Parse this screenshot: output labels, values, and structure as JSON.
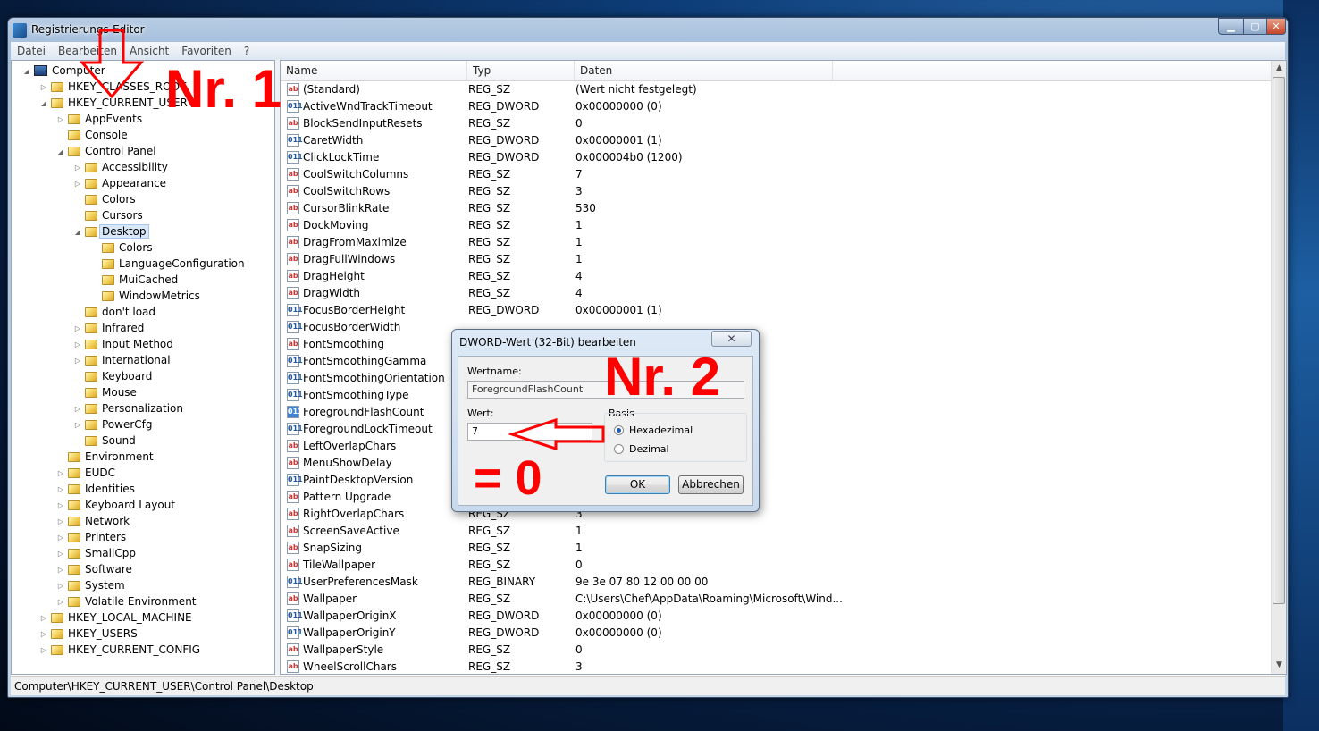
{
  "window": {
    "title": "Registrierungs-Editor",
    "min": "▁",
    "max": "▢",
    "close": "✕"
  },
  "menu": [
    "Datei",
    "Bearbeiten",
    "Ansicht",
    "Favoriten",
    "?"
  ],
  "tree": [
    {
      "label": "Computer",
      "level": 0,
      "exp": "◢",
      "icon": "pc"
    },
    {
      "label": "HKEY_CLASSES_ROOT",
      "level": 1,
      "exp": "▷"
    },
    {
      "label": "HKEY_CURRENT_USER",
      "level": 1,
      "exp": "◢"
    },
    {
      "label": "AppEvents",
      "level": 2,
      "exp": "▷"
    },
    {
      "label": "Console",
      "level": 2,
      "exp": ""
    },
    {
      "label": "Control Panel",
      "level": 2,
      "exp": "◢"
    },
    {
      "label": "Accessibility",
      "level": 3,
      "exp": "▷"
    },
    {
      "label": "Appearance",
      "level": 3,
      "exp": "▷"
    },
    {
      "label": "Colors",
      "level": 3,
      "exp": ""
    },
    {
      "label": "Cursors",
      "level": 3,
      "exp": ""
    },
    {
      "label": "Desktop",
      "level": 3,
      "exp": "◢",
      "selected": true
    },
    {
      "label": "Colors",
      "level": 4,
      "exp": ""
    },
    {
      "label": "LanguageConfiguration",
      "level": 4,
      "exp": ""
    },
    {
      "label": "MuiCached",
      "level": 4,
      "exp": ""
    },
    {
      "label": "WindowMetrics",
      "level": 4,
      "exp": ""
    },
    {
      "label": "don't load",
      "level": 3,
      "exp": ""
    },
    {
      "label": "Infrared",
      "level": 3,
      "exp": "▷"
    },
    {
      "label": "Input Method",
      "level": 3,
      "exp": "▷"
    },
    {
      "label": "International",
      "level": 3,
      "exp": "▷"
    },
    {
      "label": "Keyboard",
      "level": 3,
      "exp": ""
    },
    {
      "label": "Mouse",
      "level": 3,
      "exp": ""
    },
    {
      "label": "Personalization",
      "level": 3,
      "exp": "▷"
    },
    {
      "label": "PowerCfg",
      "level": 3,
      "exp": "▷"
    },
    {
      "label": "Sound",
      "level": 3,
      "exp": ""
    },
    {
      "label": "Environment",
      "level": 2,
      "exp": ""
    },
    {
      "label": "EUDC",
      "level": 2,
      "exp": "▷"
    },
    {
      "label": "Identities",
      "level": 2,
      "exp": "▷"
    },
    {
      "label": "Keyboard Layout",
      "level": 2,
      "exp": "▷"
    },
    {
      "label": "Network",
      "level": 2,
      "exp": "▷"
    },
    {
      "label": "Printers",
      "level": 2,
      "exp": "▷"
    },
    {
      "label": "SmallCpp",
      "level": 2,
      "exp": "▷"
    },
    {
      "label": "Software",
      "level": 2,
      "exp": "▷"
    },
    {
      "label": "System",
      "level": 2,
      "exp": "▷"
    },
    {
      "label": "Volatile Environment",
      "level": 2,
      "exp": "▷"
    },
    {
      "label": "HKEY_LOCAL_MACHINE",
      "level": 1,
      "exp": "▷"
    },
    {
      "label": "HKEY_USERS",
      "level": 1,
      "exp": "▷"
    },
    {
      "label": "HKEY_CURRENT_CONFIG",
      "level": 1,
      "exp": "▷"
    }
  ],
  "columns": [
    "Name",
    "Typ",
    "Daten"
  ],
  "rows": [
    {
      "name": "(Standard)",
      "type": "REG_SZ",
      "data": "(Wert nicht festgelegt)",
      "icon": "ab"
    },
    {
      "name": "ActiveWndTrackTimeout",
      "type": "REG_DWORD",
      "data": "0x00000000 (0)",
      "icon": "bin"
    },
    {
      "name": "BlockSendInputResets",
      "type": "REG_SZ",
      "data": "0",
      "icon": "ab"
    },
    {
      "name": "CaretWidth",
      "type": "REG_DWORD",
      "data": "0x00000001 (1)",
      "icon": "bin"
    },
    {
      "name": "ClickLockTime",
      "type": "REG_DWORD",
      "data": "0x000004b0 (1200)",
      "icon": "bin"
    },
    {
      "name": "CoolSwitchColumns",
      "type": "REG_SZ",
      "data": "7",
      "icon": "ab"
    },
    {
      "name": "CoolSwitchRows",
      "type": "REG_SZ",
      "data": "3",
      "icon": "ab"
    },
    {
      "name": "CursorBlinkRate",
      "type": "REG_SZ",
      "data": "530",
      "icon": "ab"
    },
    {
      "name": "DockMoving",
      "type": "REG_SZ",
      "data": "1",
      "icon": "ab"
    },
    {
      "name": "DragFromMaximize",
      "type": "REG_SZ",
      "data": "1",
      "icon": "ab"
    },
    {
      "name": "DragFullWindows",
      "type": "REG_SZ",
      "data": "1",
      "icon": "ab"
    },
    {
      "name": "DragHeight",
      "type": "REG_SZ",
      "data": "4",
      "icon": "ab"
    },
    {
      "name": "DragWidth",
      "type": "REG_SZ",
      "data": "4",
      "icon": "ab"
    },
    {
      "name": "FocusBorderHeight",
      "type": "REG_DWORD",
      "data": "0x00000001 (1)",
      "icon": "bin"
    },
    {
      "name": "FocusBorderWidth",
      "type": "",
      "data": "",
      "icon": "bin"
    },
    {
      "name": "FontSmoothing",
      "type": "",
      "data": "",
      "icon": "ab"
    },
    {
      "name": "FontSmoothingGamma",
      "type": "",
      "data": "",
      "icon": "bin"
    },
    {
      "name": "FontSmoothingOrientation",
      "type": "",
      "data": "",
      "icon": "bin"
    },
    {
      "name": "FontSmoothingType",
      "type": "",
      "data": "",
      "icon": "bin"
    },
    {
      "name": "ForegroundFlashCount",
      "type": "",
      "data": "",
      "icon": "bin",
      "highlight": true
    },
    {
      "name": "ForegroundLockTimeout",
      "type": "",
      "data": "",
      "icon": "bin"
    },
    {
      "name": "LeftOverlapChars",
      "type": "",
      "data": "",
      "icon": "ab"
    },
    {
      "name": "MenuShowDelay",
      "type": "",
      "data": "",
      "icon": "ab"
    },
    {
      "name": "PaintDesktopVersion",
      "type": "",
      "data": "",
      "icon": "bin"
    },
    {
      "name": "Pattern Upgrade",
      "type": "",
      "data": "",
      "icon": "ab"
    },
    {
      "name": "RightOverlapChars",
      "type": "REG_SZ",
      "data": "3",
      "icon": "ab"
    },
    {
      "name": "ScreenSaveActive",
      "type": "REG_SZ",
      "data": "1",
      "icon": "ab"
    },
    {
      "name": "SnapSizing",
      "type": "REG_SZ",
      "data": "1",
      "icon": "ab"
    },
    {
      "name": "TileWallpaper",
      "type": "REG_SZ",
      "data": "0",
      "icon": "ab"
    },
    {
      "name": "UserPreferencesMask",
      "type": "REG_BINARY",
      "data": "9e 3e 07 80 12 00 00 00",
      "icon": "bin"
    },
    {
      "name": "Wallpaper",
      "type": "REG_SZ",
      "data": "C:\\Users\\Chef\\AppData\\Roaming\\Microsoft\\Wind...",
      "icon": "ab"
    },
    {
      "name": "WallpaperOriginX",
      "type": "REG_DWORD",
      "data": "0x00000000 (0)",
      "icon": "bin"
    },
    {
      "name": "WallpaperOriginY",
      "type": "REG_DWORD",
      "data": "0x00000000 (0)",
      "icon": "bin"
    },
    {
      "name": "WallpaperStyle",
      "type": "REG_SZ",
      "data": "0",
      "icon": "ab"
    },
    {
      "name": "WheelScrollChars",
      "type": "REG_SZ",
      "data": "3",
      "icon": "ab"
    }
  ],
  "icon_text": {
    "ab": "ab",
    "bin": "011"
  },
  "status": "Computer\\HKEY_CURRENT_USER\\Control Panel\\Desktop",
  "dialog": {
    "title": "DWORD-Wert (32-Bit) bearbeiten",
    "close": "✕",
    "name_label": "Wertname:",
    "name_value": "ForegroundFlashCount",
    "value_label": "Wert:",
    "value": "7",
    "base_label": "Basis",
    "hex_label": "Hexadezimal",
    "dec_label": "Dezimal",
    "ok": "OK",
    "cancel": "Abbrechen"
  },
  "annotations": {
    "nr1": "Nr. 1",
    "nr2": "Nr. 2",
    "zero": "= 0"
  },
  "colors": {
    "annotation": "#ff0000",
    "selection": "#d9e8f9"
  }
}
